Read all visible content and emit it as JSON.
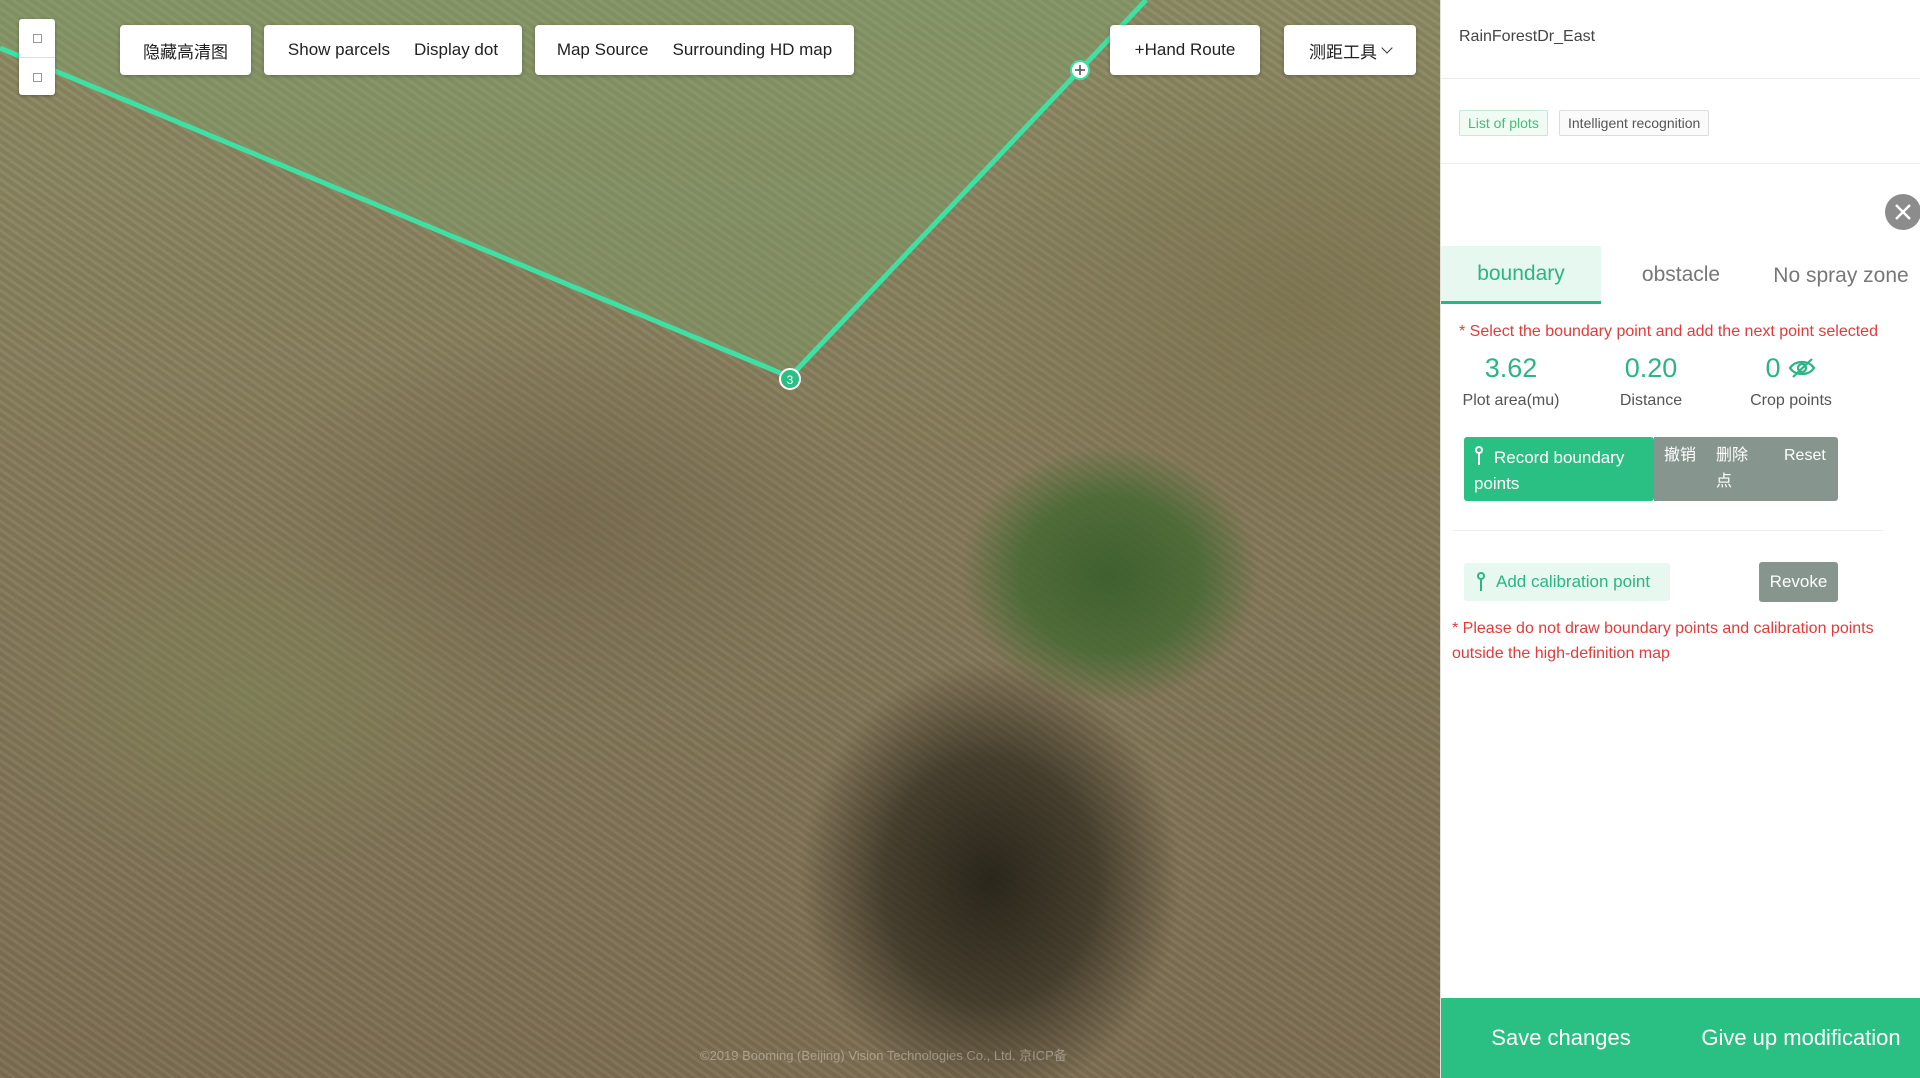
{
  "map": {
    "toolbar": {
      "hide_hd_label": "隐藏高清图",
      "show_parcels_label": "Show parcels",
      "display_dot_label": "Display dot",
      "map_source_label": "Map Source",
      "surrounding_hd_label": "Surrounding HD map",
      "hand_route_label": "+Hand Route",
      "measure_tool_label": "测距工具"
    },
    "boundary_point_label": "3",
    "copyright": "©2019 Booming (Beijing) Vision Technologies Co., Ltd. 京ICP备"
  },
  "panel": {
    "title": "RainForestDr_East",
    "chips": {
      "list_of_plots": "List of plots",
      "intelligent_recognition": "Intelligent recognition"
    },
    "tabs": {
      "boundary": "boundary",
      "obstacle": "obstacle",
      "no_spray_zone": "No spray zone"
    },
    "boundary_hint": "* Select the boundary point and add the next point selected",
    "stats": {
      "plot_area": {
        "value": "3.62",
        "label": "Plot area(mu)"
      },
      "distance": {
        "value": "0.20",
        "label": "Distance"
      },
      "crop_points": {
        "value": "0",
        "label": "Crop points"
      }
    },
    "buttons": {
      "record_boundary": "Record boundary points",
      "undo": "撤销",
      "delete_point": "删除点",
      "reset": "Reset",
      "add_calibration": "Add calibration point",
      "revoke": "Revoke"
    },
    "calibration_hint": "* Please do not draw boundary points and calibration points outside the high-definition map",
    "footer": {
      "save": "Save changes",
      "give_up": "Give up modification"
    }
  },
  "colors": {
    "accent": "#2bc083",
    "boundary_line": "#3fe0a3",
    "warning": "#e23b3b",
    "grey_button": "#87958f"
  }
}
